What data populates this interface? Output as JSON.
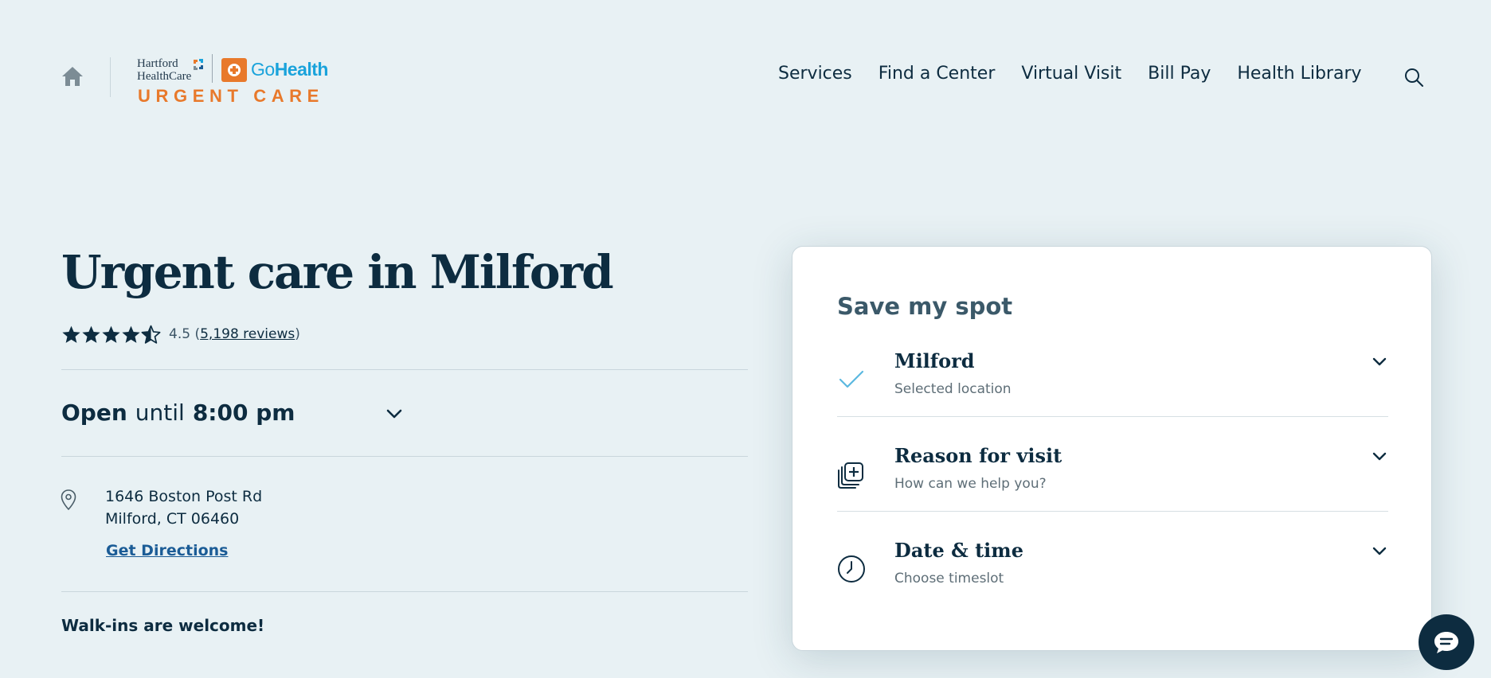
{
  "header": {
    "logo": {
      "hhc_line1": "Hartford",
      "hhc_line2": "HealthCare",
      "gohealth_go": "Go",
      "gohealth_health": "Health",
      "urgent_care": "URGENT CARE"
    },
    "nav": [
      {
        "label": "Services"
      },
      {
        "label": "Find a Center"
      },
      {
        "label": "Virtual Visit"
      },
      {
        "label": "Bill Pay"
      },
      {
        "label": "Health Library"
      }
    ],
    "icons": {
      "home": "home-icon",
      "search": "search-icon"
    }
  },
  "main": {
    "title": "Urgent care in Milford",
    "rating": {
      "value": "4.5",
      "stars": 4.5,
      "reviews": "5,198 reviews"
    },
    "hours": {
      "status": "Open",
      "until": "until",
      "time": "8:00 pm"
    },
    "address": {
      "line1": "1646 Boston Post Rd",
      "line2": "Milford, CT 06460"
    },
    "directions_label": "Get Directions",
    "walkins": "Walk-ins are welcome!"
  },
  "card": {
    "title": "Save my spot",
    "steps": [
      {
        "title": "Milford",
        "subtitle": "Selected location",
        "icon": "check-icon"
      },
      {
        "title": "Reason for visit",
        "subtitle": "How can we help you?",
        "icon": "medical-plus-icon"
      },
      {
        "title": "Date & time",
        "subtitle": "Choose timeslot",
        "icon": "clock-icon"
      }
    ]
  },
  "colors": {
    "background": "#e8f1f4",
    "navy": "#0d2c40",
    "link": "#1b5c96",
    "orange": "#e8792b",
    "gohealth_blue": "#1aa3db",
    "check_blue": "#5bb8e0"
  }
}
